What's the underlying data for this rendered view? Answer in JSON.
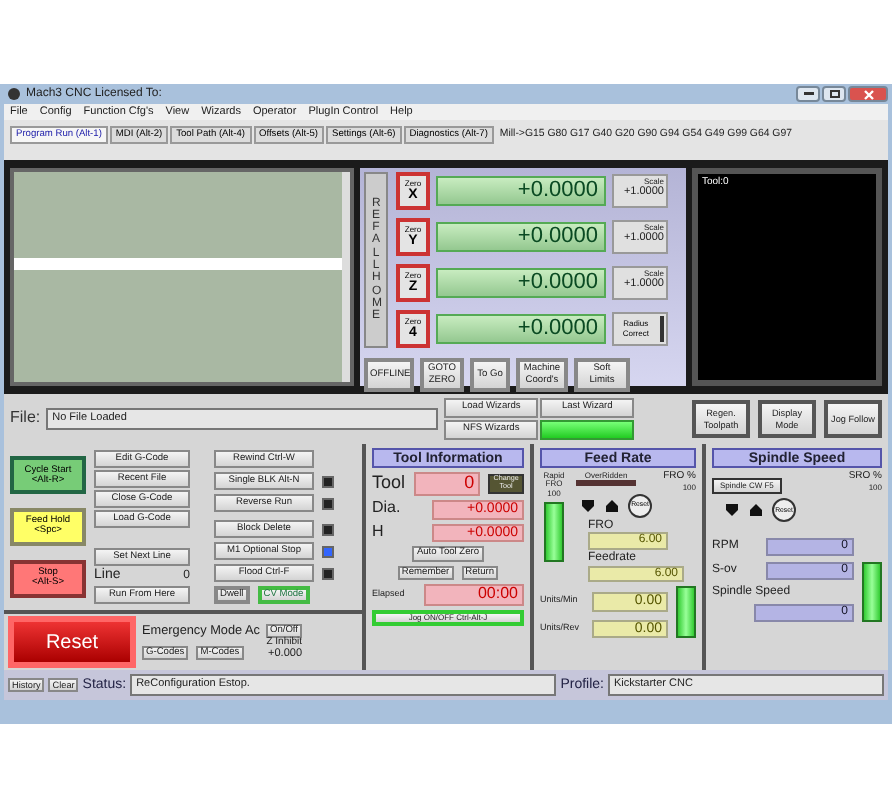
{
  "window": {
    "title": "Mach3 CNC  Licensed To:"
  },
  "menu": [
    "File",
    "Config",
    "Function Cfg's",
    "View",
    "Wizards",
    "Operator",
    "PlugIn Control",
    "Help"
  ],
  "tabs": [
    {
      "label": "Program Run (Alt-1)",
      "selected": true
    },
    {
      "label": "MDI (Alt-2)",
      "selected": false
    },
    {
      "label": "Tool Path (Alt-4)",
      "selected": false
    },
    {
      "label": "Offsets (Alt-5)",
      "selected": false
    },
    {
      "label": "Settings (Alt-6)",
      "selected": false
    },
    {
      "label": "Diagnostics (Alt-7)",
      "selected": false
    }
  ],
  "modal_state": "Mill->G15  G80 G17 G40 G20 G90 G94 G54 G49 G99 G64 G97",
  "dro": {
    "ref_all_home": "REF ALL HOME",
    "axes": [
      {
        "zero_button": "Zero",
        "axis": "X",
        "value": "+0.0000",
        "kind": "scale",
        "side_label": "Scale",
        "side_value": "+1.0000"
      },
      {
        "zero_button": "Zero",
        "axis": "Y",
        "value": "+0.0000",
        "kind": "scale",
        "side_label": "Scale",
        "side_value": "+1.0000"
      },
      {
        "zero_button": "Zero",
        "axis": "Z",
        "value": "+0.0000",
        "kind": "scale",
        "side_label": "Scale",
        "side_value": "+1.0000"
      },
      {
        "zero_button": "Zero",
        "axis": "4",
        "value": "+0.0000",
        "kind": "radius",
        "side_label": "Radius Correct"
      }
    ],
    "buttons": [
      "OFFLINE",
      "GOTO ZERO",
      "To Go",
      "Machine Coord's",
      "Soft Limits"
    ]
  },
  "toolpath": {
    "label": "Tool:0"
  },
  "file": {
    "label": "File:",
    "value": "No File Loaded"
  },
  "wizards": [
    "Load Wizards",
    "Last Wizard",
    "NFS Wizards"
  ],
  "view_buttons": [
    "Regen. Toolpath",
    "Display Mode",
    "Jog Follow"
  ],
  "cycle_buttons": [
    {
      "label": "Cycle Start",
      "shortcut": "<Alt-R>",
      "kind": "start"
    },
    {
      "label": "Feed Hold",
      "shortcut": "<Spc>",
      "kind": "hold"
    },
    {
      "label": "Stop",
      "shortcut": "<Alt-S>",
      "kind": "stop"
    }
  ],
  "gcode_buttons": [
    "Edit G-Code",
    "Recent File",
    "Close G-Code",
    "Load G-Code"
  ],
  "set_next_line": "Set Next Line",
  "line": {
    "label": "Line",
    "value": "0"
  },
  "run_from_here": "Run From Here",
  "run_buttons": [
    {
      "label": "Rewind Ctrl-W",
      "kind": "button"
    },
    {
      "label": "Single BLK Alt-N",
      "kind": "toggle",
      "on": false
    },
    {
      "label": "Reverse Run",
      "kind": "toggle",
      "on": false
    }
  ],
  "mode_buttons": [
    {
      "label": "Block Delete",
      "on": false
    },
    {
      "label": "M1 Optional Stop",
      "on": true
    },
    {
      "label": "Flood Ctrl-F",
      "on": false
    }
  ],
  "dwell": {
    "label": "Dwell",
    "on": false
  },
  "cv_mode": {
    "label": "CV Mode",
    "on": true
  },
  "reset": "Reset",
  "emergency": "Emergency Mode Ac",
  "code_buttons": [
    "G-Codes",
    "M-Codes"
  ],
  "on_off": "On/Off",
  "z_inhibit": {
    "label": "Z Inhibit",
    "value": "+0.000"
  },
  "tool_info": {
    "title": "Tool Information",
    "tool": {
      "label": "Tool",
      "value": "0"
    },
    "change_tool": "Change Tool",
    "dia": {
      "label": "Dia.",
      "value": "+0.0000"
    },
    "h": {
      "label": "H",
      "value": "+0.0000"
    },
    "auto_tool_zero": "Auto Tool Zero",
    "remember": "Remember",
    "return": "Return",
    "elapsed": {
      "label": "Elapsed",
      "value": "00:00"
    },
    "jog": {
      "label": "Jog ON/OFF Ctrl-Alt-J",
      "on": true
    }
  },
  "feed_rate": {
    "title": "Feed Rate",
    "overridden": {
      "label": "OverRidden",
      "on": false
    },
    "fro_percent": {
      "label": "FRO %",
      "value": "100"
    },
    "rapid_fro": {
      "label": "Rapid FRO",
      "value": "100"
    },
    "reset": "Reset",
    "fro": {
      "label": "FRO",
      "value": "6.00"
    },
    "feedrate": {
      "label": "Feedrate",
      "value": "6.00"
    },
    "units_min": {
      "label": "Units/Min",
      "value": "0.00"
    },
    "units_rev": {
      "label": "Units/Rev",
      "value": "0.00"
    }
  },
  "spindle": {
    "title": "Spindle Speed",
    "direction_button": "Spindle CW F5",
    "sro_percent": {
      "label": "SRO %",
      "value": "100"
    },
    "reset": "Reset",
    "rpm": {
      "label": "RPM",
      "value": "0"
    },
    "s_ov": {
      "label": "S-ov",
      "value": "0"
    },
    "spindle_speed": {
      "label": "Spindle Speed",
      "value": "0"
    }
  },
  "status_bar": {
    "buttons": [
      "History",
      "Clear"
    ],
    "status_label": "Status:",
    "status": "ReConfiguration Estop.",
    "profile_label": "Profile:",
    "profile": "Kickstarter CNC"
  }
}
